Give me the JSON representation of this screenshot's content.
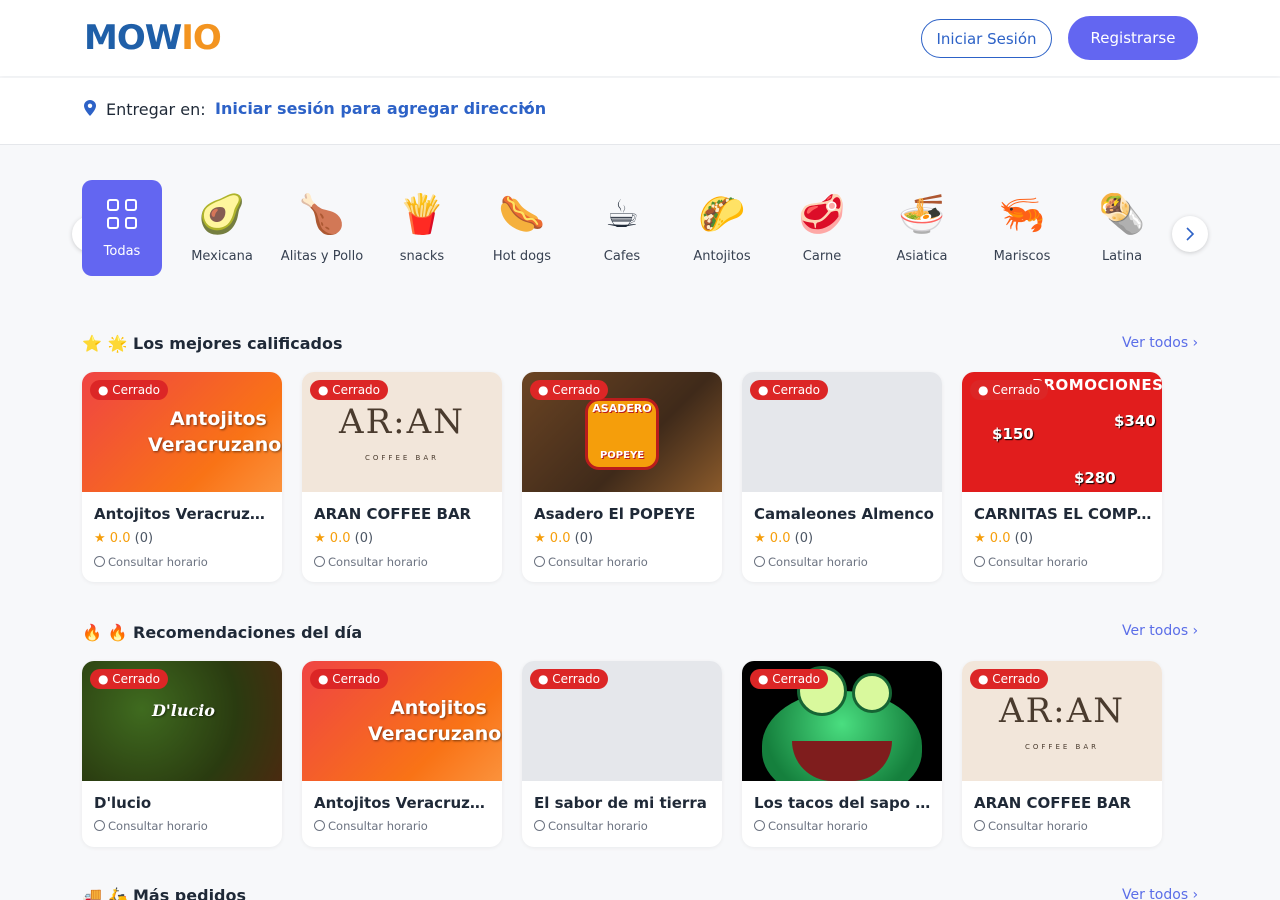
{
  "header": {
    "logo_part1": "MOW",
    "logo_part2": "IO",
    "login_label": "Iniciar Sesión",
    "register_label": "Registrarse"
  },
  "delivery": {
    "label": "Entregar en:",
    "value": "Iniciar sesión para agregar dirección"
  },
  "categories": [
    {
      "name": "Todas",
      "icon": "grid-icon"
    },
    {
      "name": "Mexicana",
      "icon": "🥑"
    },
    {
      "name": "Alitas y Pollo",
      "icon": "🍗"
    },
    {
      "name": "snacks",
      "icon": "🍟"
    },
    {
      "name": "Hot dogs",
      "icon": "🌭"
    },
    {
      "name": "Cafes",
      "icon": "☕"
    },
    {
      "name": "Antojitos",
      "icon": "🌮"
    },
    {
      "name": "Carne",
      "icon": "🥩"
    },
    {
      "name": "Asiatica",
      "icon": "🍜"
    },
    {
      "name": "Mariscos",
      "icon": "🦐"
    },
    {
      "name": "Latina",
      "icon": "🌯"
    }
  ],
  "sections": [
    {
      "title": "🌟 Los mejores calificados",
      "lead_icon": "⭐",
      "see_all": "Ver todos ›",
      "cards": [
        {
          "name": "Antojitos Veracruzanos",
          "badge": "● Cerrado",
          "score": "0.0",
          "count": "(0)",
          "hours": "Consultar horario",
          "art": "antojitos",
          "art_text1": "Antojitos",
          "art_text2": "Veracruzanos"
        },
        {
          "name": "ARAN COFFEE BAR",
          "badge": "● Cerrado",
          "score": "0.0",
          "count": "(0)",
          "hours": "Consultar horario",
          "art": "aran",
          "art_text1": "AR:AN",
          "art_text2": "COFFEE BAR"
        },
        {
          "name": "Asadero El POPEYE",
          "badge": "● Cerrado",
          "score": "0.0",
          "count": "(0)",
          "hours": "Consultar horario",
          "art": "popeye",
          "art_text1": "ASADERO",
          "art_text2": "POPEYE"
        },
        {
          "name": "Camaleones Almenco",
          "badge": "● Cerrado",
          "score": "0.0",
          "count": "(0)",
          "hours": "Consultar horario",
          "art": "empty",
          "art_text1": "",
          "art_text2": ""
        },
        {
          "name": "CARNITAS EL COMPAYITO",
          "badge": "● Cerrado",
          "score": "0.0",
          "count": "(0)",
          "hours": "Consultar horario",
          "art": "carnitas",
          "art_text1": "PROMOCIONES",
          "art_text2": "$150",
          "art_text3": "$340",
          "art_text4": "$280"
        }
      ]
    },
    {
      "title": "🔥 Recomendaciones del día",
      "lead_icon": "🔥",
      "see_all": "Ver todos ›",
      "cards": [
        {
          "name": "D'lucio",
          "badge": "● Cerrado",
          "hours": "Consultar horario",
          "art": "dlucio",
          "art_text1": "D'lucio",
          "art_text2": ""
        },
        {
          "name": "Antojitos Veracruzanos",
          "badge": "● Cerrado",
          "hours": "Consultar horario",
          "art": "antojitos",
          "art_text1": "Antojitos",
          "art_text2": "Veracruzanos"
        },
        {
          "name": "El sabor de mi tierra",
          "badge": "● Cerrado",
          "hours": "Consultar horario",
          "art": "empty",
          "art_text1": "",
          "art_text2": ""
        },
        {
          "name": "Los tacos del sapo las palmas",
          "badge": "● Cerrado",
          "hours": "Consultar horario",
          "art": "sapo",
          "art_text1": "",
          "art_text2": ""
        },
        {
          "name": "ARAN COFFEE BAR",
          "badge": "● Cerrado",
          "hours": "Consultar horario",
          "art": "aran",
          "art_text1": "AR:AN",
          "art_text2": "COFFEE BAR"
        }
      ]
    },
    {
      "title": "🛵 Más pedidos",
      "lead_icon": "🚚",
      "see_all": "Ver todos ›"
    }
  ],
  "colors": {
    "primary": "#6366f1",
    "link": "#2d62c7",
    "closed_badge": "#dc2626",
    "star": "#f59e0b"
  }
}
